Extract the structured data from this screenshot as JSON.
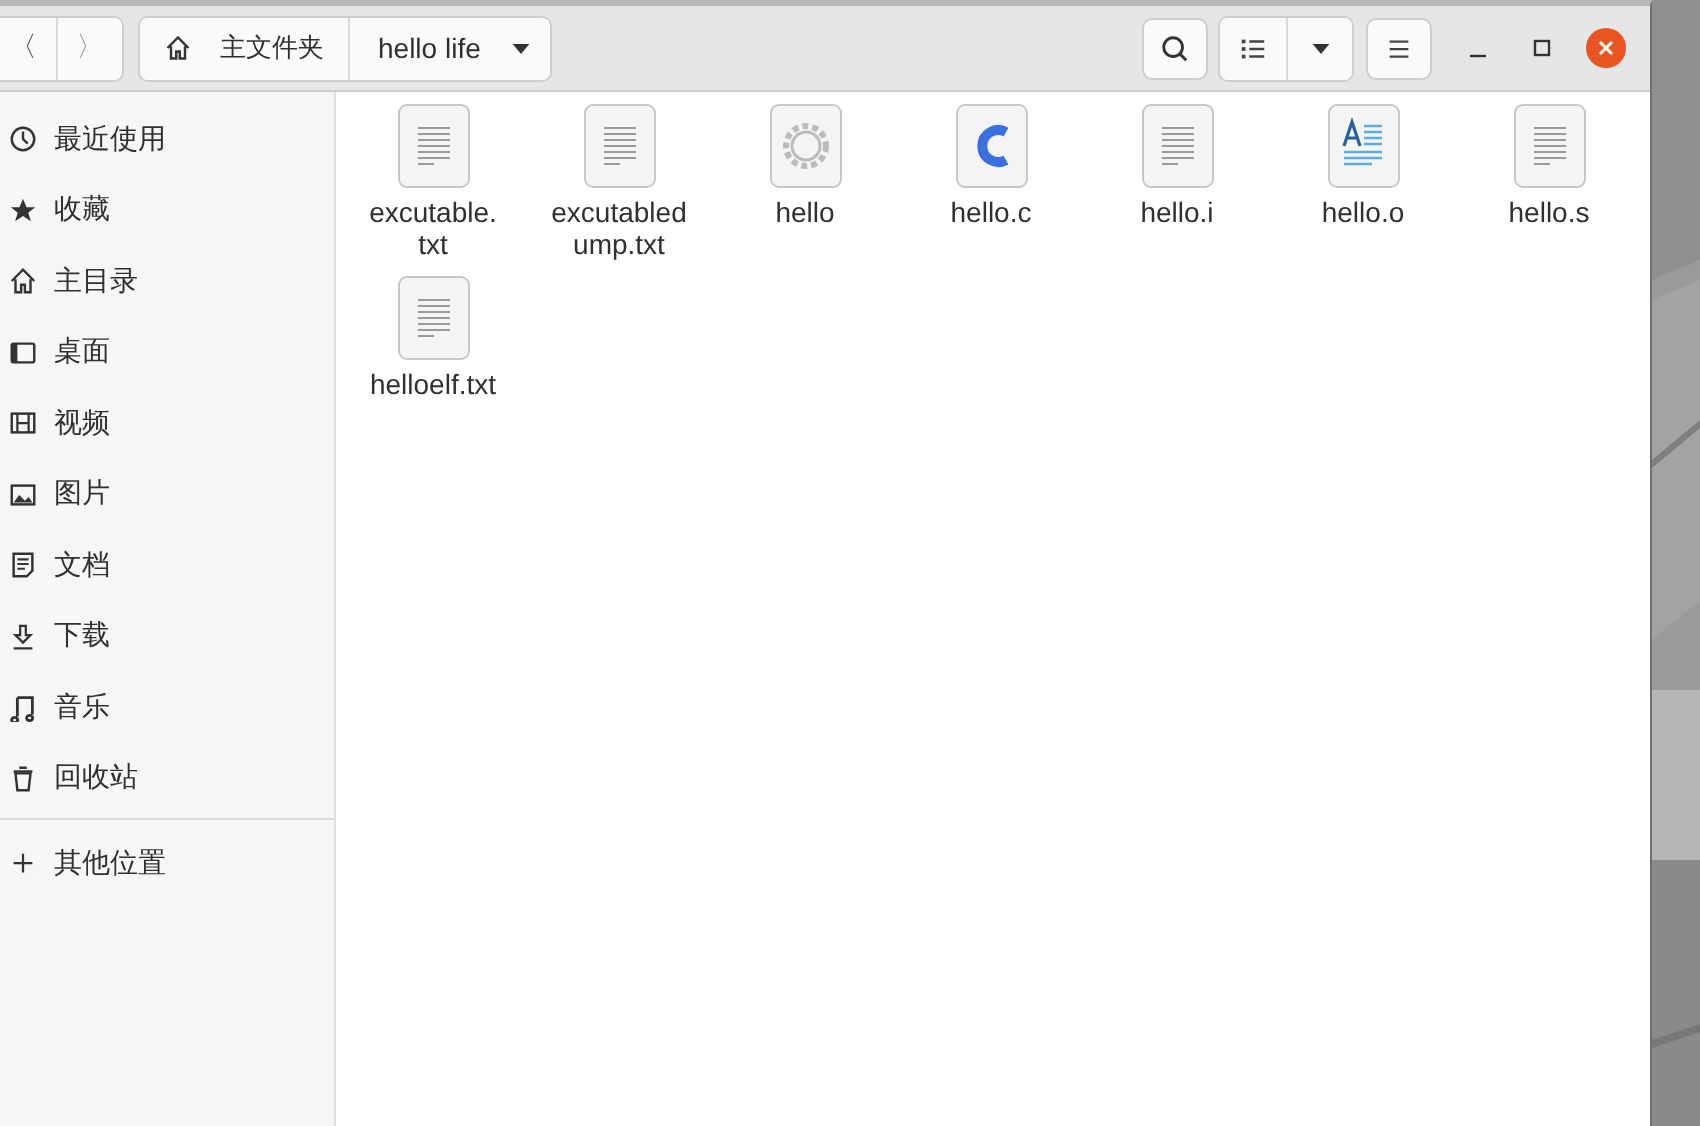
{
  "header": {
    "nav": {
      "back": "〈",
      "forward": "〉"
    },
    "path": [
      {
        "label": "主文件夹",
        "kind": "home"
      },
      {
        "label": "hello life",
        "kind": "current"
      }
    ]
  },
  "sidebar": {
    "items": [
      {
        "label": "最近使用",
        "kind": "recent",
        "selected": false
      },
      {
        "label": "收藏",
        "kind": "star",
        "selected": false
      },
      {
        "label": "主目录",
        "kind": "home",
        "selected": false
      },
      {
        "label": "桌面",
        "kind": "desktop",
        "selected": false
      },
      {
        "label": "视频",
        "kind": "video",
        "selected": false
      },
      {
        "label": "图片",
        "kind": "picture",
        "selected": false
      },
      {
        "label": "文档",
        "kind": "document",
        "selected": false
      },
      {
        "label": "下载",
        "kind": "download",
        "selected": false
      },
      {
        "label": "音乐",
        "kind": "music",
        "selected": false
      },
      {
        "label": "回收站",
        "kind": "trash",
        "selected": false
      }
    ],
    "other": {
      "label": "其他位置",
      "kind": "add"
    }
  },
  "files": [
    {
      "name": "excutable.\ntxt",
      "kind": "text",
      "selected": false
    },
    {
      "name": "excutabled\nump.txt",
      "kind": "text",
      "selected": false
    },
    {
      "name": "hello",
      "kind": "executable",
      "selected": false
    },
    {
      "name": "hello.c",
      "kind": "c",
      "selected": false
    },
    {
      "name": "hello.i",
      "kind": "text",
      "selected": false
    },
    {
      "name": "hello.o",
      "kind": "doc",
      "selected": false
    },
    {
      "name": "hello.s",
      "kind": "text",
      "selected": false
    },
    {
      "name": "helloelf.txt",
      "kind": "text",
      "selected": false
    }
  ]
}
